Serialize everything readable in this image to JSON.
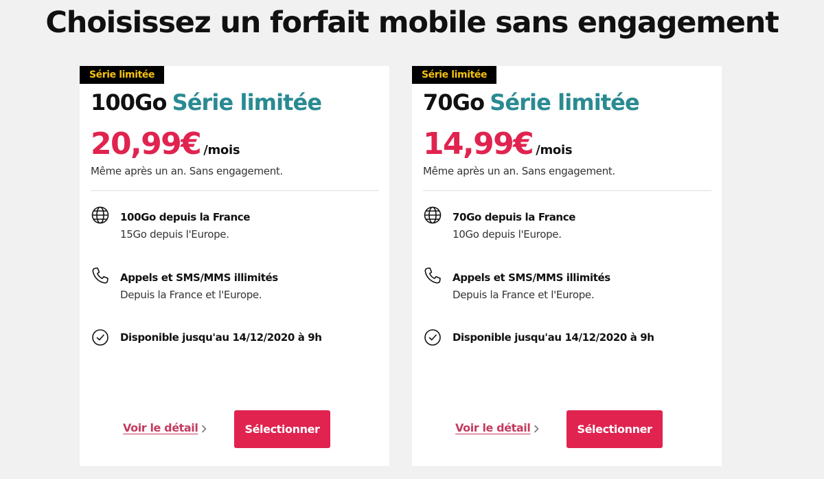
{
  "page": {
    "title": "Choisissez un forfait mobile sans engagement"
  },
  "colors": {
    "accent": "#e0234f",
    "series": "#2a8a92",
    "badge_bg": "#000000",
    "badge_text": "#f4c20d"
  },
  "plans": [
    {
      "badge": "Série limitée",
      "data_label": "100Go",
      "series_label": "Série limitée",
      "price": "20,99€",
      "period": "/mois",
      "price_note": "Même après un an. Sans engagement.",
      "features": [
        {
          "icon": "globe-icon",
          "title": "100Go depuis la France",
          "subtitle": "15Go depuis l'Europe."
        },
        {
          "icon": "phone-icon",
          "title": "Appels et SMS/MMS illimités",
          "subtitle": "Depuis la France et l'Europe."
        },
        {
          "icon": "clock-icon",
          "title": "Disponible jusqu'au 14/12/2020 à 9h",
          "subtitle": ""
        }
      ],
      "detail_link": "Voir le détail",
      "select_button": "Sélectionner"
    },
    {
      "badge": "Série limitée",
      "data_label": "70Go",
      "series_label": "Série limitée",
      "price": "14,99€",
      "period": "/mois",
      "price_note": "Même après un an. Sans engagement.",
      "features": [
        {
          "icon": "globe-icon",
          "title": "70Go depuis la France",
          "subtitle": "10Go depuis l'Europe."
        },
        {
          "icon": "phone-icon",
          "title": "Appels et SMS/MMS illimités",
          "subtitle": "Depuis la France et l'Europe."
        },
        {
          "icon": "clock-icon",
          "title": "Disponible jusqu'au 14/12/2020 à 9h",
          "subtitle": ""
        }
      ],
      "detail_link": "Voir le détail",
      "select_button": "Sélectionner"
    }
  ]
}
